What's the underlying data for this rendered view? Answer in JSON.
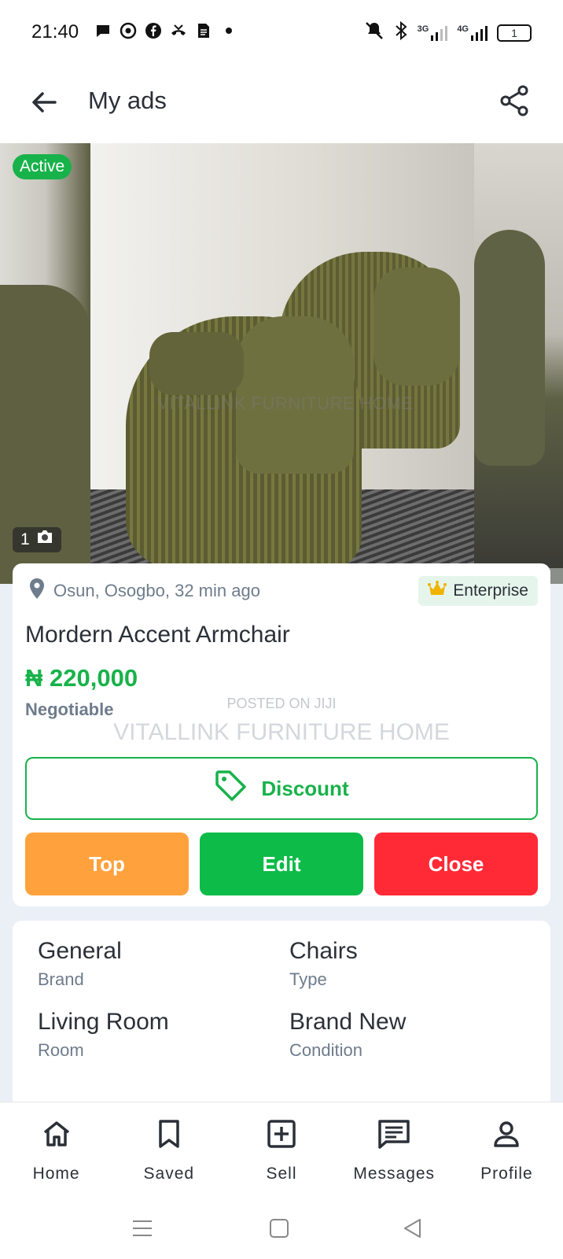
{
  "status_bar": {
    "time": "21:40",
    "network_3g": "3G",
    "network_4g": "4G",
    "battery": "1"
  },
  "app_bar": {
    "title": "My ads"
  },
  "gallery": {
    "status_badge": "Active",
    "photo_count": "1",
    "watermark": "VITALLINK FURNITURE HOME"
  },
  "ad": {
    "location": "Osun, Osogbo, 32 min ago",
    "seller_tier": "Enterprise",
    "title": "Mordern Accent Armchair",
    "price": "₦ 220,000",
    "negotiable": "Negotiable",
    "watermark_small": "POSTED ON JIJI",
    "watermark_large": "VITALLINK FURNITURE HOME"
  },
  "actions": {
    "discount": "Discount",
    "top": "Top",
    "edit": "Edit",
    "close": "Close"
  },
  "attributes": [
    {
      "value": "General",
      "label": "Brand"
    },
    {
      "value": "Chairs",
      "label": "Type"
    },
    {
      "value": "Living Room",
      "label": "Room"
    },
    {
      "value": "Brand New",
      "label": "Condition"
    }
  ],
  "bottom_nav": {
    "home": "Home",
    "saved": "Saved",
    "sell": "Sell",
    "messages": "Messages",
    "profile": "Profile"
  },
  "colors": {
    "primary": "#18b24a",
    "top": "#ffa23d",
    "edit": "#0dbb48",
    "close": "#ff2a36",
    "muted": "#6e7c8c"
  }
}
